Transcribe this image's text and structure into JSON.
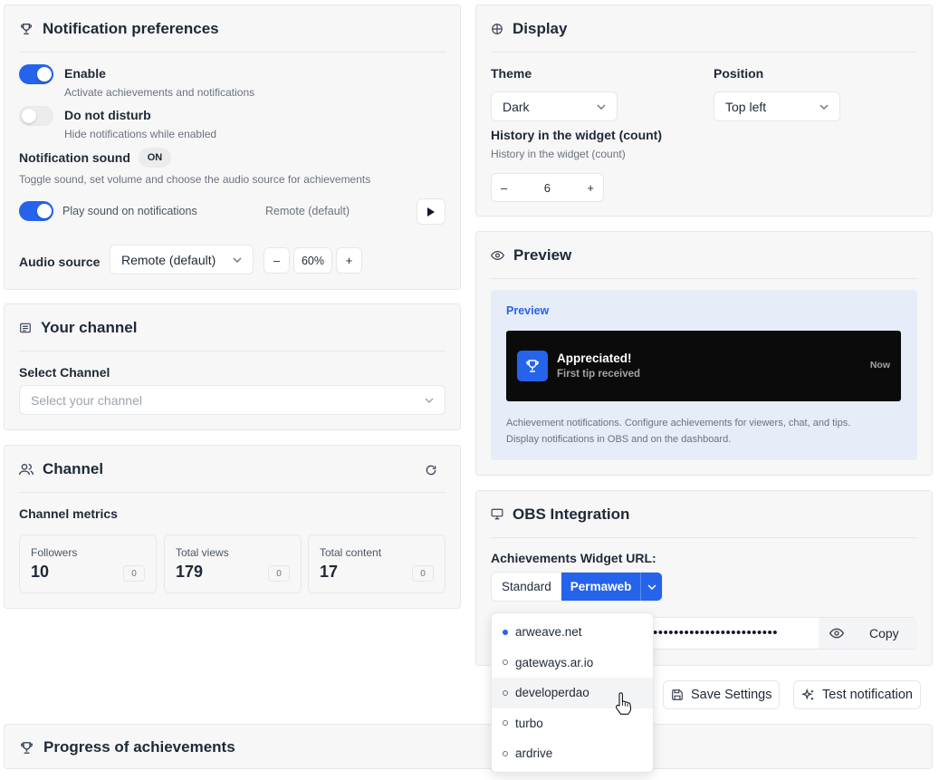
{
  "notif": {
    "title": "Notification preferences",
    "enable_label": "Enable",
    "enable_sub": "Activate achievements and notifications",
    "dnd_label": "Do not disturb",
    "dnd_sub": "Hide notifications while enabled",
    "sound_label": "Notification sound",
    "sound_badge": "ON",
    "sound_sub": "Toggle sound, set volume and choose the audio source for achievements",
    "play_label": "Play sound on notifications",
    "play_source": "Remote (default)",
    "audio_label": "Audio source",
    "audio_value": "Remote (default)",
    "minus": "–",
    "plus": "+",
    "volume": "60%"
  },
  "your_channel": {
    "title": "Your channel",
    "select_label": "Select Channel",
    "select_placeholder": "Select your channel"
  },
  "channel": {
    "title": "Channel",
    "metrics_label": "Channel metrics",
    "metrics": [
      {
        "label": "Followers",
        "value": "10",
        "badge": "0"
      },
      {
        "label": "Total views",
        "value": "179",
        "badge": "0"
      },
      {
        "label": "Total content",
        "value": "17",
        "badge": "0"
      }
    ]
  },
  "progress": {
    "title": "Progress of achievements"
  },
  "display": {
    "title": "Display",
    "theme_label": "Theme",
    "theme_value": "Dark",
    "position_label": "Position",
    "position_value": "Top left",
    "history_label": "History in the widget (count)",
    "history_sub": "History in the widget (count)",
    "history_value": "6",
    "minus": "–",
    "plus": "+"
  },
  "preview": {
    "title": "Preview",
    "inner_label": "Preview",
    "notif_title": "Appreciated!",
    "notif_sub": "First tip received",
    "notif_time": "Now",
    "description_line1": "Achievement notifications. Configure achievements for viewers, chat, and tips.",
    "description_line2": "Display notifications in OBS and on the dashboard."
  },
  "obs": {
    "title": "OBS Integration",
    "url_label": "Achievements Widget URL:",
    "tab_standard": "Standard",
    "tab_permaweb": "Permaweb",
    "url_masked": "••••••••••••••••••••••••",
    "copy_label": "Copy"
  },
  "gateway_menu": {
    "items": [
      "arweave.net",
      "gateways.ar.io",
      "developerdao",
      "turbo",
      "ardrive"
    ]
  },
  "actions": {
    "save": "Save Settings",
    "test": "Test notification"
  },
  "colors": {
    "accent": "#2563eb",
    "card_bg": "#f7f7f7",
    "preview_bg": "#e6edf8",
    "toast_bg": "#0b0b0b"
  }
}
